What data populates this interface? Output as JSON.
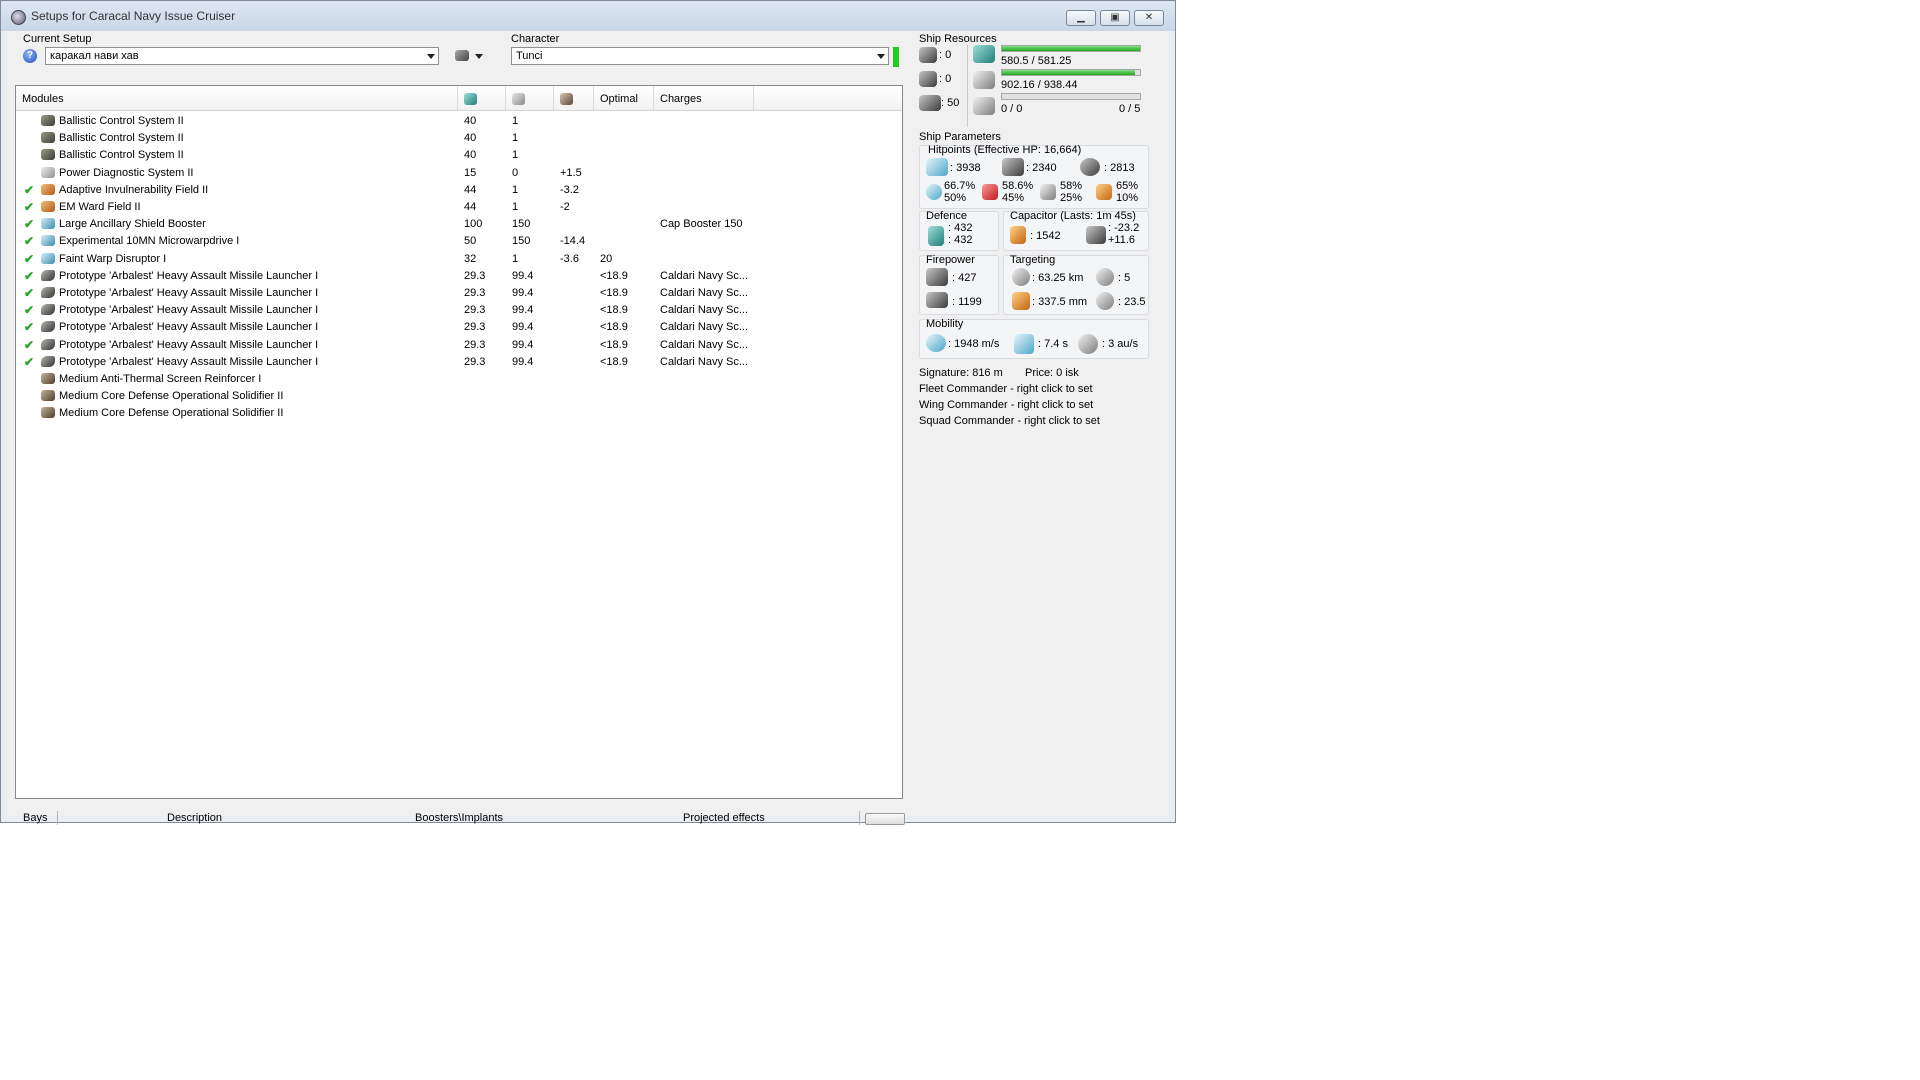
{
  "window": {
    "title": "Setups for Caracal Navy Issue Cruiser",
    "controls": [
      "minimize-icon",
      "maximize-icon",
      "close-icon"
    ]
  },
  "setup": {
    "label": "Current Setup",
    "value": "каракал нави хав",
    "help_icon": "help-icon",
    "tools_icon": "wrench-icon"
  },
  "character": {
    "label": "Character",
    "value": "Tunci",
    "status_color": "#22cc22"
  },
  "modules": {
    "headers": {
      "name": "Modules",
      "cpu": "cpu-icon",
      "pg": "powergrid-icon",
      "cap": "capacitor-icon",
      "optimal": "Optimal",
      "charges": "Charges"
    },
    "rows": [
      {
        "checked": false,
        "icon": "mi-dark",
        "name": "Ballistic Control System II",
        "cpu": "40",
        "pg": "1",
        "cap": "",
        "optimal": "",
        "charge": ""
      },
      {
        "checked": false,
        "icon": "mi-dark",
        "name": "Ballistic Control System II",
        "cpu": "40",
        "pg": "1",
        "cap": "",
        "optimal": "",
        "charge": ""
      },
      {
        "checked": false,
        "icon": "mi-dark",
        "name": "Ballistic Control System II",
        "cpu": "40",
        "pg": "1",
        "cap": "",
        "optimal": "",
        "charge": ""
      },
      {
        "checked": false,
        "icon": "mi-grey",
        "name": "Power Diagnostic System II",
        "cpu": "15",
        "pg": "0",
        "cap": "+1.5",
        "optimal": "",
        "charge": ""
      },
      {
        "checked": true,
        "icon": "mi-orange",
        "name": "Adaptive Invulnerability Field II",
        "cpu": "44",
        "pg": "1",
        "cap": "-3.2",
        "optimal": "",
        "charge": ""
      },
      {
        "checked": true,
        "icon": "mi-orange",
        "name": "EM Ward Field II",
        "cpu": "44",
        "pg": "1",
        "cap": "-2",
        "optimal": "",
        "charge": ""
      },
      {
        "checked": true,
        "icon": "mi-cyan",
        "name": "Large Ancillary Shield Booster",
        "cpu": "100",
        "pg": "150",
        "cap": "",
        "optimal": "",
        "charge": "Cap Booster 150"
      },
      {
        "checked": true,
        "icon": "mi-cyan",
        "name": "Experimental 10MN Microwarpdrive I",
        "cpu": "50",
        "pg": "150",
        "cap": "-14.4",
        "optimal": "",
        "charge": ""
      },
      {
        "checked": true,
        "icon": "mi-cyan",
        "name": "Faint Warp Disruptor I",
        "cpu": "32",
        "pg": "1",
        "cap": "-3.6",
        "optimal": "20",
        "charge": ""
      },
      {
        "checked": true,
        "icon": "mi-launcher",
        "name": "Prototype 'Arbalest' Heavy Assault Missile Launcher I",
        "cpu": "29.3",
        "pg": "99.4",
        "cap": "",
        "optimal": "<18.9",
        "charge": "Caldari Navy Sc..."
      },
      {
        "checked": true,
        "icon": "mi-launcher",
        "name": "Prototype 'Arbalest' Heavy Assault Missile Launcher I",
        "cpu": "29.3",
        "pg": "99.4",
        "cap": "",
        "optimal": "<18.9",
        "charge": "Caldari Navy Sc..."
      },
      {
        "checked": true,
        "icon": "mi-launcher",
        "name": "Prototype 'Arbalest' Heavy Assault Missile Launcher I",
        "cpu": "29.3",
        "pg": "99.4",
        "cap": "",
        "optimal": "<18.9",
        "charge": "Caldari Navy Sc..."
      },
      {
        "checked": true,
        "icon": "mi-launcher",
        "name": "Prototype 'Arbalest' Heavy Assault Missile Launcher I",
        "cpu": "29.3",
        "pg": "99.4",
        "cap": "",
        "optimal": "<18.9",
        "charge": "Caldari Navy Sc..."
      },
      {
        "checked": true,
        "icon": "mi-launcher",
        "name": "Prototype 'Arbalest' Heavy Assault Missile Launcher I",
        "cpu": "29.3",
        "pg": "99.4",
        "cap": "",
        "optimal": "<18.9",
        "charge": "Caldari Navy Sc..."
      },
      {
        "checked": true,
        "icon": "mi-launcher",
        "name": "Prototype 'Arbalest' Heavy Assault Missile Launcher I",
        "cpu": "29.3",
        "pg": "99.4",
        "cap": "",
        "optimal": "<18.9",
        "charge": "Caldari Navy Sc..."
      },
      {
        "checked": false,
        "icon": "mi-brown",
        "name": "Medium Anti-Thermal Screen Reinforcer I",
        "cpu": "",
        "pg": "",
        "cap": "",
        "optimal": "",
        "charge": ""
      },
      {
        "checked": false,
        "icon": "mi-brown",
        "name": "Medium Core Defense Operational Solidifier II",
        "cpu": "",
        "pg": "",
        "cap": "",
        "optimal": "",
        "charge": ""
      },
      {
        "checked": false,
        "icon": "mi-brown",
        "name": "Medium Core Defense Operational Solidifier II",
        "cpu": "",
        "pg": "",
        "cap": "",
        "optimal": "",
        "charge": ""
      }
    ]
  },
  "bottom_tabs": [
    "Bays",
    "Description",
    "Boosters\\Implants",
    "Projected effects"
  ],
  "resources": {
    "title": "Ship Resources",
    "hardpoints": [
      {
        "icon": "turret-icon",
        "value": ": 0"
      },
      {
        "icon": "launcher-icon",
        "value": ": 0"
      },
      {
        "icon": "drone-bay-icon",
        "value": ": 50"
      }
    ],
    "cpu": {
      "icon": "cpu-icon",
      "text": "580.5 / 581.25",
      "fraction": 0.9987
    },
    "powergrid": {
      "icon": "powergrid-icon",
      "text": "902.16 / 938.44",
      "fraction": 0.9613
    },
    "drones": {
      "icon": "drone-icon",
      "bandwidth": "0 / 0",
      "count": "0 / 5",
      "fraction": 0
    }
  },
  "params": {
    "title": "Ship Parameters",
    "hitpoints": {
      "title": "Hitpoints (Effective HP: 16,664)",
      "shield": ": 3938",
      "armor": ": 2340",
      "structure": ": 2813",
      "resists": [
        {
          "icon": "em-icon",
          "top": "66.7%",
          "bottom": "50%"
        },
        {
          "icon": "thermal-icon",
          "top": "58.6%",
          "bottom": "45%"
        },
        {
          "icon": "kinetic-icon",
          "top": "58%",
          "bottom": "25%"
        },
        {
          "icon": "explosive-icon",
          "top": "65%",
          "bottom": "10%"
        }
      ]
    },
    "defence": {
      "title": "Defence",
      "top": ": 432",
      "bottom": ": 432"
    },
    "capacitor": {
      "title": "Capacitor (Lasts: 1m 45s)",
      "amount": ": 1542",
      "delta_top": ": -23.2",
      "delta_bottom": "+11.6"
    },
    "firepower": {
      "title": "Firepower",
      "dps": ": 427",
      "volley": ": 1199"
    },
    "targeting": {
      "title": "Targeting",
      "range": ": 63.25 km",
      "targets": ": 5",
      "resolution": ": 337.5 mm",
      "sensor": ": 23.5"
    },
    "mobility": {
      "title": "Mobility",
      "speed": ": 1948 m/s",
      "align": ": 7.4 s",
      "warp": ": 3 au/s"
    }
  },
  "footer": {
    "signature": "Signature: 816 m",
    "price": "Price: 0 isk",
    "fleet": "Fleet Commander - right click to set",
    "wing": "Wing Commander - right click to set",
    "squad": "Squad Commander - right click to set"
  }
}
